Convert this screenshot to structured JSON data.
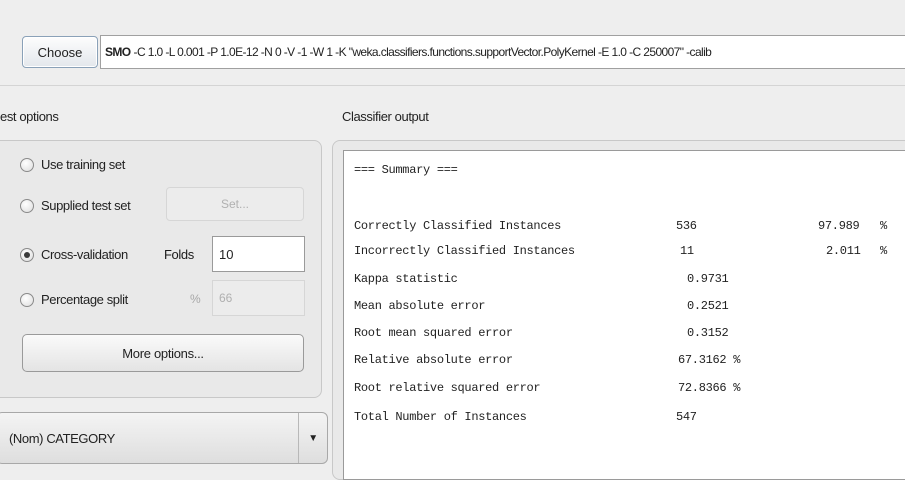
{
  "classifier": {
    "choose_label": "Choose",
    "scheme_name": "SMO",
    "scheme_options": "-C 1.0 -L 0.001 -P 1.0E-12 -N 0 -V -1 -W 1 -K \"weka.classifiers.functions.supportVector.PolyKernel -E 1.0 -C 250007\" -calib"
  },
  "test_options": {
    "title": "est options",
    "use_training_label": "Use training set",
    "supplied_test_label": "Supplied test set",
    "set_button_label": "Set...",
    "cross_validation_label": "Cross-validation",
    "folds_label": "Folds",
    "folds_value": "10",
    "percentage_split_label": "Percentage split",
    "percent_sign": "%",
    "percentage_value": "66",
    "more_options_label": "More options...",
    "selected_option": "cross-validation"
  },
  "class_attribute": {
    "selected": "(Nom) CATEGORY"
  },
  "output": {
    "title": "Classifier output",
    "summary_header": "=== Summary ===",
    "rows": [
      {
        "label": "Correctly Classified Instances",
        "value": "536",
        "extra": "97.989",
        "unit": "%"
      },
      {
        "label": "Incorrectly Classified Instances",
        "value": "11",
        "extra": "2.011",
        "unit": "%"
      },
      {
        "label": "Kappa statistic",
        "value": "0.9731"
      },
      {
        "label": "Mean absolute error",
        "value": "0.2521"
      },
      {
        "label": "Root mean squared error",
        "value": "0.3152"
      },
      {
        "label": "Relative absolute error",
        "value": "67.3162 %"
      },
      {
        "label": "Root relative squared error",
        "value": "72.8366 %"
      },
      {
        "label": "Total Number of Instances",
        "value": "547"
      }
    ]
  },
  "colors": {
    "background": "#eeeeee",
    "panel": "#e9e9e9",
    "text_area": "#ffffff",
    "disabled_text": "#b0b0b0"
  }
}
